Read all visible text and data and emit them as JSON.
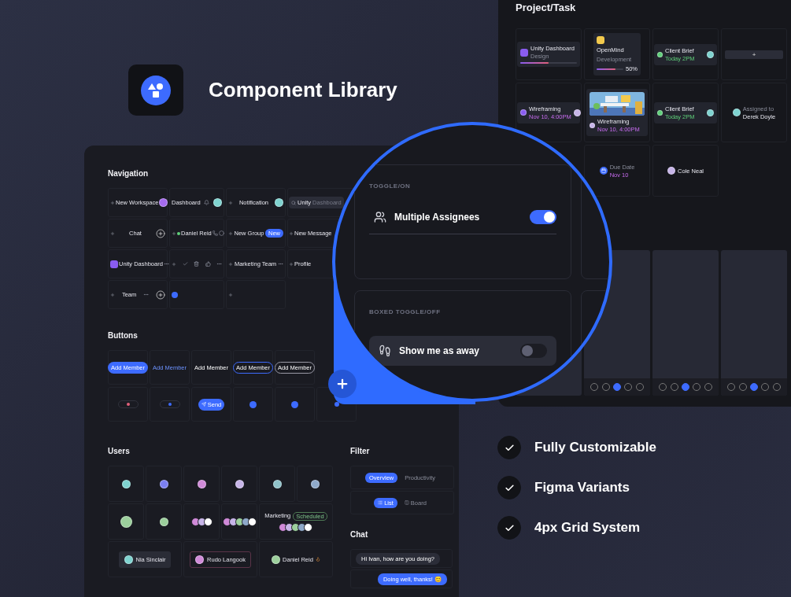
{
  "brand": {
    "title": "Component Library"
  },
  "library": {
    "navigation": {
      "title": "Navigation",
      "cells": [
        {
          "items": [
            {
              "kind": "add"
            },
            {
              "kind": "text",
              "label": "New Workspace"
            },
            {
              "kind": "avatar",
              "color": "#a66cf0"
            }
          ]
        },
        {
          "items": [
            {
              "kind": "text",
              "label": "Dashboard"
            },
            {
              "kind": "bell"
            },
            {
              "kind": "avatar",
              "color": "#7fd3d0"
            }
          ]
        },
        {
          "items": [
            {
              "kind": "add"
            },
            {
              "kind": "text",
              "label": "Notification"
            },
            {
              "kind": "avatar",
              "color": "#7fd3d0"
            }
          ]
        },
        {
          "items": [
            {
              "kind": "search",
              "value": "Unity",
              "placeholder": "Dashboard"
            }
          ]
        },
        {
          "items": [
            {
              "kind": "add"
            },
            {
              "kind": "text",
              "label": "Chat"
            },
            {
              "kind": "plus-circle"
            }
          ]
        },
        {
          "items": [
            {
              "kind": "add"
            },
            {
              "kind": "status",
              "label": "Daniel Reid"
            },
            {
              "kind": "phone"
            },
            {
              "kind": "ring"
            }
          ]
        },
        {
          "items": [
            {
              "kind": "add"
            },
            {
              "kind": "text",
              "label": "New Group"
            },
            {
              "kind": "badge",
              "label": "New"
            }
          ]
        },
        {
          "items": [
            {
              "kind": "add"
            },
            {
              "kind": "text",
              "label": "New Message"
            }
          ]
        },
        {
          "items": [
            {
              "kind": "app"
            },
            {
              "kind": "text",
              "label": "Unity Dashboard"
            },
            {
              "kind": "dots"
            }
          ]
        },
        {
          "items": [
            {
              "kind": "add"
            },
            {
              "kind": "check"
            },
            {
              "kind": "trash"
            },
            {
              "kind": "thumbs"
            },
            {
              "kind": "dots"
            }
          ]
        },
        {
          "items": [
            {
              "kind": "add"
            },
            {
              "kind": "text",
              "label": "Marketing Team"
            },
            {
              "kind": "dots"
            }
          ]
        },
        {
          "items": [
            {
              "kind": "add"
            },
            {
              "kind": "text",
              "label": "Profile"
            }
          ]
        },
        {
          "items": [
            {
              "kind": "add"
            },
            {
              "kind": "text",
              "label": "Team"
            },
            {
              "kind": "dots"
            },
            {
              "kind": "plus-circle"
            }
          ]
        },
        {
          "items": [
            {
              "kind": "dot"
            }
          ]
        },
        {
          "items": [
            {
              "kind": "add"
            }
          ]
        }
      ]
    },
    "buttons": {
      "title": "Buttons",
      "cells": [
        {
          "kind": "filled",
          "label": "Add Member"
        },
        {
          "kind": "text-accent",
          "label": "Add Member"
        },
        {
          "kind": "text-plain",
          "label": "Add Member"
        },
        {
          "kind": "outline-accent",
          "label": "Add Member"
        },
        {
          "kind": "outline-plain",
          "label": "Add Member"
        },
        {
          "kind": "empty"
        },
        {
          "kind": "icon-pill",
          "color": "#e0607a"
        },
        {
          "kind": "icon-pill",
          "color": "#3d6bff"
        },
        {
          "kind": "filled-icon",
          "label": "Send"
        },
        {
          "kind": "round"
        },
        {
          "kind": "round"
        },
        {
          "kind": "small-dot"
        }
      ]
    },
    "users": {
      "title": "Users",
      "cells": [
        {
          "kind": "avatar",
          "color": "#7fd3d0"
        },
        {
          "kind": "avatar",
          "color": "#7b7ff0"
        },
        {
          "kind": "avatar",
          "color": "#d08ad8"
        },
        {
          "kind": "avatar",
          "color": "#c7b5e8"
        },
        {
          "kind": "avatar",
          "color": "#8fc2c9"
        },
        {
          "kind": "avatar",
          "color": "#8fa9c9"
        },
        {
          "kind": "avatar-large",
          "color": "#9ccf9c"
        },
        {
          "kind": "avatar",
          "color": "#9ccf9c"
        },
        {
          "kind": "group-small"
        },
        {
          "kind": "group-large"
        },
        {
          "kind": "team",
          "label": "Marketing",
          "tag": "Scheduled"
        },
        {
          "kind": "card",
          "name": "Nia Sinclair",
          "color": "#7fd3d0"
        },
        {
          "kind": "card-outline",
          "name": "Rudo Langook",
          "color": "#d08ad8"
        },
        {
          "kind": "inline",
          "name": "Daniel Reid",
          "color": "#9ccf9c"
        }
      ]
    },
    "filter": {
      "title": "Filter",
      "tabs": [
        {
          "label": "Overview",
          "selected": true
        },
        {
          "label": "Productivity",
          "selected": false
        }
      ],
      "views": [
        {
          "label": "List",
          "selected": true
        },
        {
          "label": "Board",
          "selected": false
        }
      ]
    },
    "chat": {
      "title": "Chat",
      "messages": [
        {
          "text": "Hi Ivan, how are you doing?",
          "outgoing": false
        },
        {
          "text": "Doing well, thanks! 😊",
          "outgoing": true
        }
      ]
    }
  },
  "project": {
    "title": "Project/Task",
    "cards": [
      {
        "kind": "project",
        "title": "Unity Dashboard",
        "subtitle": "Design",
        "level": 0.5
      },
      {
        "kind": "board",
        "title": "OpenMind",
        "subtitle": "Development",
        "reading": "50%",
        "level": 0.7
      },
      {
        "kind": "task",
        "title": "Client Brief",
        "subtitle": "Today 2PM"
      },
      {
        "kind": "add",
        "label": "+"
      },
      {
        "kind": "progress",
        "title": "Wireframing",
        "subtitle": "Nov 10, 4:00PM"
      },
      {
        "title": "Wireframing",
        "subtitle": "Nov 10, 4:00PM"
      },
      {
        "kind": "task",
        "title": "Client Brief",
        "subtitle": "Today 2PM"
      },
      {
        "kind": "assignee",
        "caption": "Assigned to",
        "name": "Derek Doyle"
      },
      {
        "kind": "empty"
      },
      {
        "kind": "due",
        "caption": "Due Date",
        "value": "Nov 10"
      },
      {
        "kind": "activity",
        "name": "Cole Neal"
      }
    ],
    "screens": [
      {
        "kind": "covered"
      },
      {
        "kind": "bar",
        "tabs": [
          {
            "selected": false
          },
          {
            "selected": false
          },
          {
            "selected": true
          },
          {
            "selected": false
          },
          {
            "selected": false
          }
        ]
      },
      {
        "kind": "bar",
        "tabs": [
          {
            "selected": false
          },
          {
            "selected": false
          },
          {
            "selected": true
          },
          {
            "selected": false
          },
          {
            "selected": false
          }
        ]
      },
      {
        "kind": "bar",
        "tabs": [
          {
            "selected": false
          },
          {
            "selected": false
          },
          {
            "selected": true
          },
          {
            "selected": false
          },
          {
            "selected": false
          }
        ]
      }
    ]
  },
  "magnifier": {
    "sections": [
      {
        "caption": "TOGGLE/ON",
        "label": "Multiple Assignees",
        "on": true,
        "boxed": false
      },
      {
        "caption": "BOXED TOGGLE/OFF",
        "label": "Show me as away",
        "on": false,
        "boxed": true
      }
    ]
  },
  "features": [
    {
      "label": "Fully Customizable",
      "checked": true
    },
    {
      "label": "Figma Variants",
      "checked": true
    },
    {
      "label": "4px Grid System",
      "checked": true
    }
  ]
}
